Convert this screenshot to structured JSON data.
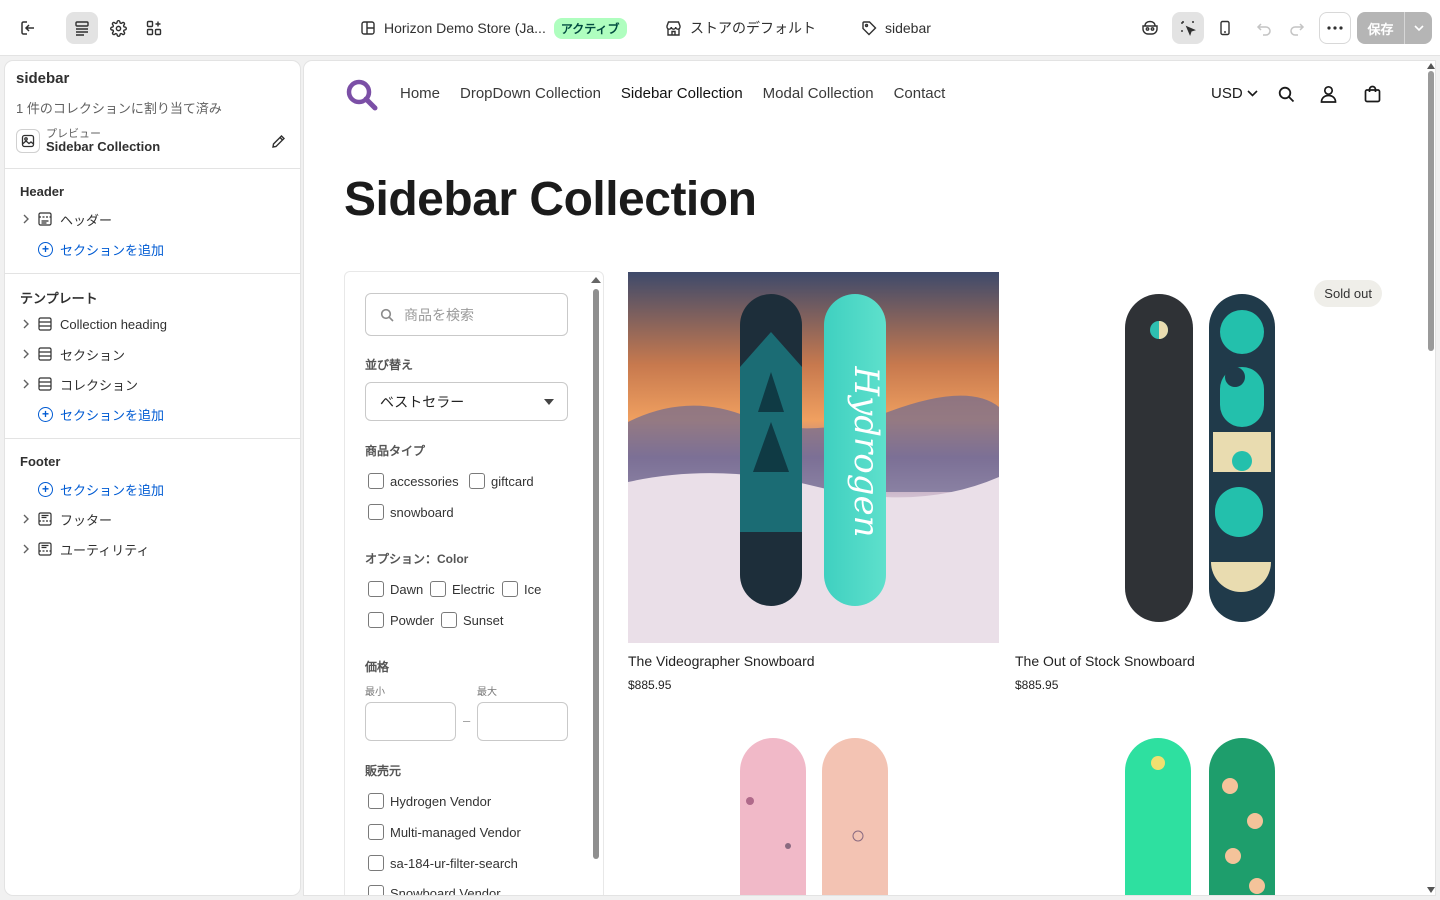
{
  "topbar": {
    "store_name": "Horizon Demo Store (Ja...",
    "status_badge": "アクティブ",
    "theme_default": "ストアのデフォルト",
    "template_name": "sidebar",
    "save_label": "保存"
  },
  "sidebar": {
    "title": "sidebar",
    "subtitle": "1 件のコレクションに割り当て済み",
    "preview_label": "プレビュー",
    "preview_value": "Sidebar Collection",
    "groups": {
      "header": {
        "heading": "Header",
        "items": [
          "ヘッダー"
        ],
        "add_label": "セクションを追加"
      },
      "template": {
        "heading": "テンプレート",
        "items": [
          "Collection heading",
          "セクション",
          "コレクション"
        ],
        "add_label": "セクションを追加"
      },
      "footer": {
        "heading": "Footer",
        "add_label": "セクションを追加",
        "items": [
          "フッター",
          "ユーティリティ"
        ]
      }
    }
  },
  "store": {
    "nav": [
      "Home",
      "DropDown Collection",
      "Sidebar Collection",
      "Modal Collection",
      "Contact"
    ],
    "active_nav": "Sidebar Collection",
    "currency": "USD",
    "page_title": "Sidebar Collection",
    "filters": {
      "search_placeholder": "商品を検索",
      "sort_label": "並び替え",
      "sort_value": "ベストセラー",
      "type_label": "商品タイプ",
      "types": [
        "accessories",
        "giftcard",
        "snowboard"
      ],
      "color_label": "オプション：Color",
      "colors": [
        "Dawn",
        "Electric",
        "Ice",
        "Powder",
        "Sunset"
      ],
      "price_label": "価格",
      "price_min": "最小",
      "price_max": "最大",
      "price_dash": "–",
      "vendor_label": "販売元",
      "vendors": [
        "Hydrogen Vendor",
        "Multi-managed Vendor",
        "sa-184-ur-filter-search",
        "Snowboard Vendor"
      ]
    },
    "products": [
      {
        "name": "The Videographer Snowboard",
        "price": "$885.95"
      },
      {
        "name": "The Out of Stock Snowboard",
        "price": "$885.95",
        "badge": "Sold out"
      }
    ]
  },
  "colors": {
    "accent": "#005bd3",
    "badge_bg": "#affebf",
    "logo": "#7b4fa6"
  }
}
